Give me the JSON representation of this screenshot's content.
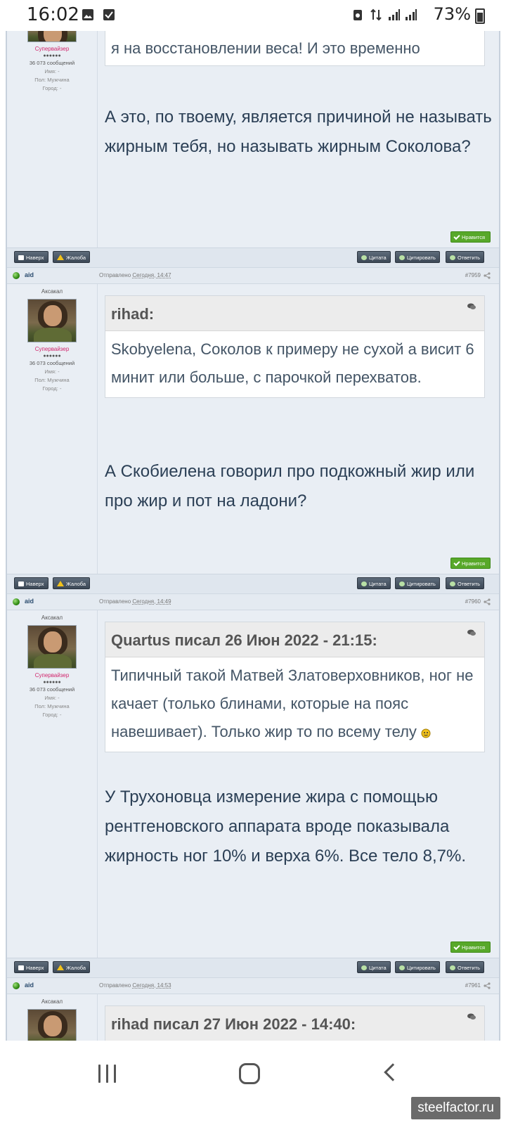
{
  "status_bar": {
    "time": "16:02",
    "battery": "73%",
    "icons": [
      "image-icon",
      "checkbox-icon",
      "recycle-icon",
      "data-arrows-icon",
      "signal-icon",
      "signal-icon",
      "battery-icon"
    ]
  },
  "author": {
    "name": "aid",
    "title": "Аксакал",
    "rank": "Супервайзер",
    "pips": "●●●●●●",
    "posts": "36 073 сообщений",
    "name_label": "Имя:",
    "name_value": "-",
    "gender_label": "Пол:",
    "gender_value": "Мужчина",
    "city_label": "Город:",
    "city_value": "-"
  },
  "buttons": {
    "up": "Наверх",
    "report": "Жалоба",
    "quote": "Цитата",
    "multiquote": "Цитировать",
    "reply": "Ответить",
    "like": "Нравится"
  },
  "posts": [
    {
      "quote_tail": "я на восстановлении веса! И это временно",
      "text": "А это, по твоему, является причиной не называть жирным тебя, но называть жирным Соколова?"
    },
    {
      "sent_prefix": "Отправлено",
      "sent_time": "Сегодня, 14:47",
      "number": "#7959",
      "quote_author": "rihad:",
      "quote_text": "Skobyelena, Соколов к примеру не сухой а висит 6 минит или больше, с парочкой перехватов.",
      "text": "А Скобиелена говорил про подкожный жир или про жир и пот на ладони?"
    },
    {
      "sent_prefix": "Отправлено",
      "sent_time": "Сегодня, 14:49",
      "number": "#7960",
      "quote_author": "Quartus писал 26 Июн 2022 - 21:15:",
      "quote_text": "Типичный такой Матвей Златоверховников, ног не качает (только блинами, которые на пояс навешивает). Только жир то по всему телу",
      "text": "У Трухоновца измерение жира с помощью рентгеновского аппарата вроде показывала жирность ног 10% и верха 6%. Все тело 8,7%."
    },
    {
      "sent_prefix": "Отправлено",
      "sent_time": "Сегодня, 14:53",
      "number": "#7961",
      "quote_author": "rihad писал 27 Июн 2022 - 14:40:"
    }
  ],
  "watermark": "steelfactor.ru"
}
